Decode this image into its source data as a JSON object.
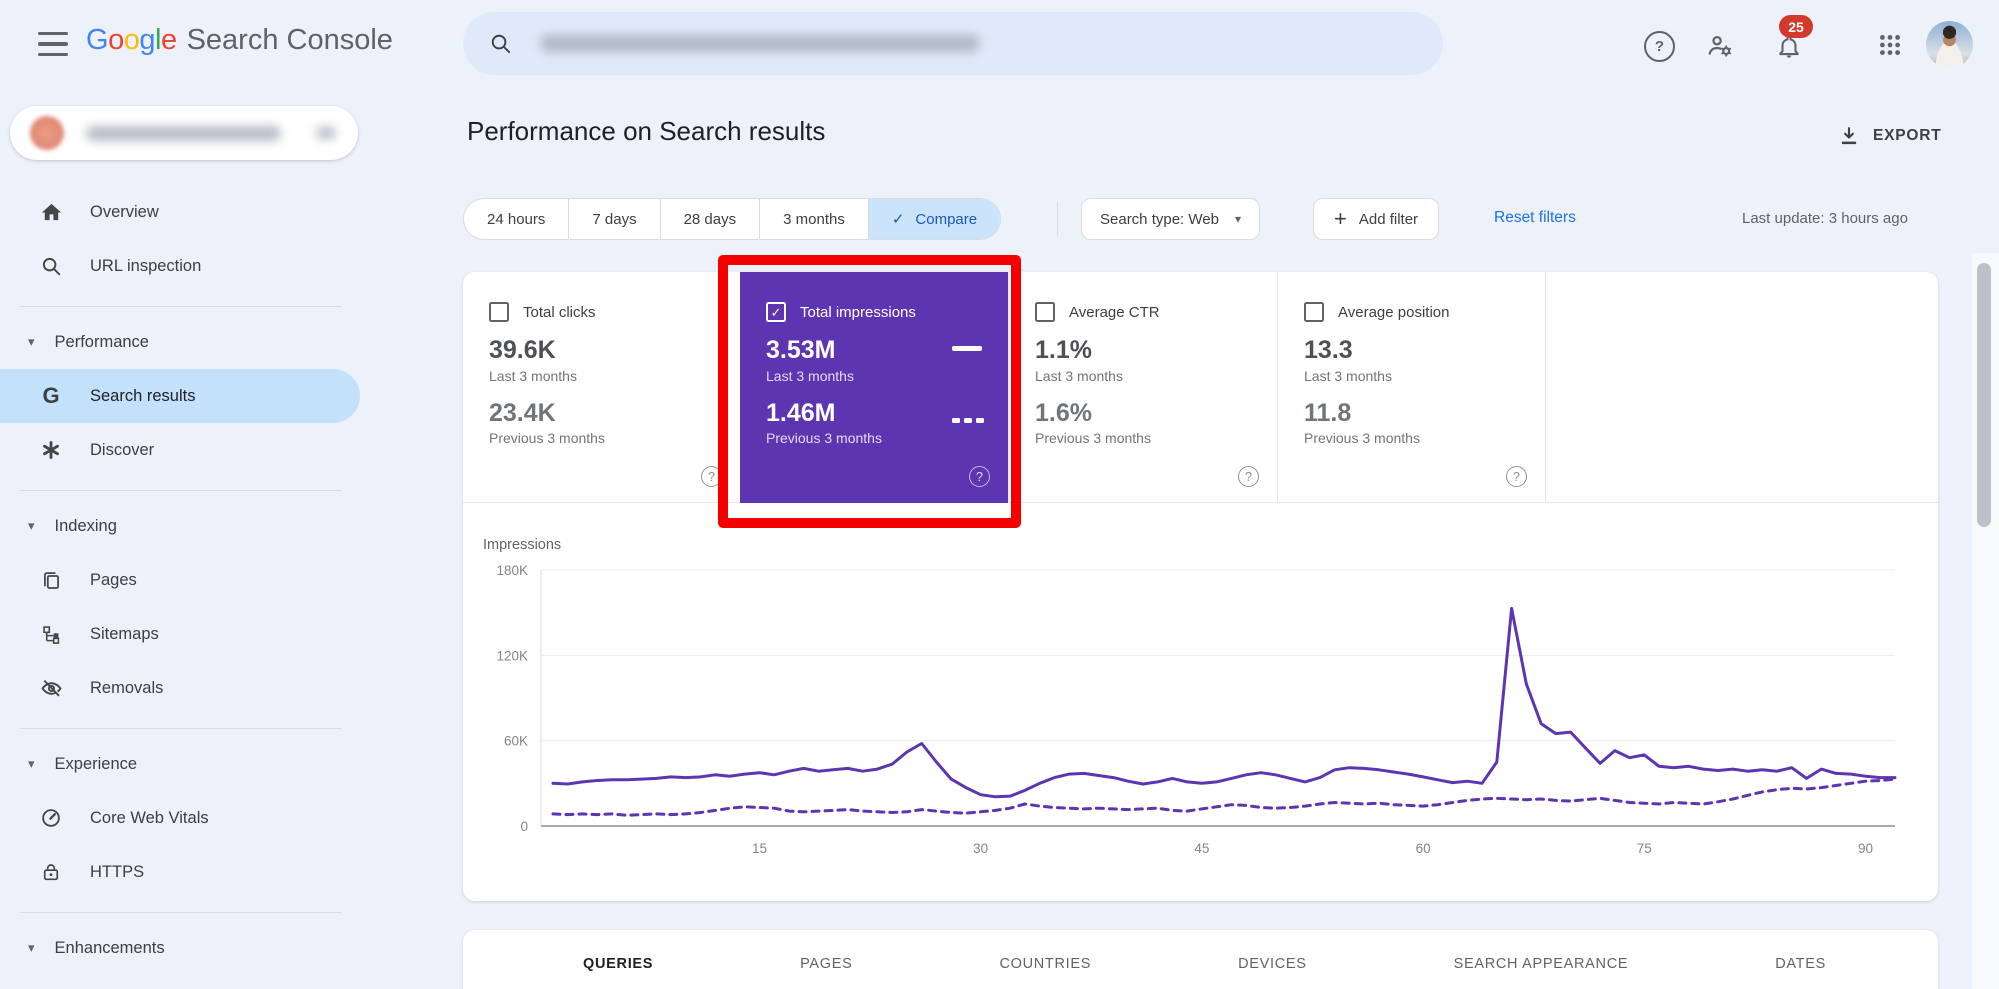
{
  "colors": {
    "page_bg": "#edf1f9",
    "accent_blue": "#1a73e8",
    "selected_chip_bg": "#cbe3fb",
    "sidebar_selected_bg": "#c3e1fb",
    "impressions_purple": "#5e35b1",
    "annotation_red": "#f50000",
    "badge_red": "#d33a2c"
  },
  "icons": {
    "compare_check": "✓",
    "checkbox_check": "✓",
    "add_filter_plus": "+",
    "dropdown_arrow": "▾",
    "section_arrow": "▾",
    "help_question": "?"
  },
  "header": {
    "logo_letters": [
      "G",
      "o",
      "o",
      "g",
      "l",
      "e"
    ],
    "logo_colors": [
      "#4285F4",
      "#EA4335",
      "#FBBC05",
      "#4285F4",
      "#34A853",
      "#EA4335"
    ],
    "logo_suffix": "Search Console",
    "notifications_badge": "25"
  },
  "sidebar": {
    "overview": "Overview",
    "url_inspection": "URL inspection",
    "performance": "Performance",
    "search_results": "Search results",
    "discover": "Discover",
    "indexing": "Indexing",
    "pages": "Pages",
    "sitemaps": "Sitemaps",
    "removals": "Removals",
    "experience": "Experience",
    "core_web_vitals": "Core Web Vitals",
    "https": "HTTPS",
    "enhancements": "Enhancements"
  },
  "main": {
    "title": "Performance on Search results",
    "export_label": "EXPORT",
    "filters": {
      "date_ranges": [
        "24 hours",
        "7 days",
        "28 days",
        "3 months"
      ],
      "compare": "Compare",
      "search_type": "Search type: Web",
      "add_filter": "Add filter",
      "reset_filters": "Reset filters",
      "last_update": "Last update: 3 hours ago"
    },
    "metric_cards": [
      {
        "label": "Total clicks",
        "checked": false,
        "current": "39.6K",
        "current_period": "Last 3 months",
        "previous": "23.4K",
        "previous_period": "Previous 3 months"
      },
      {
        "label": "Total impressions",
        "checked": true,
        "highlight_color": "#5e35b1",
        "current": "3.53M",
        "current_period": "Last 3 months",
        "previous": "1.46M",
        "previous_period": "Previous 3 months"
      },
      {
        "label": "Average CTR",
        "checked": false,
        "current": "1.1%",
        "current_period": "Last 3 months",
        "previous": "1.6%",
        "previous_period": "Previous 3 months"
      },
      {
        "label": "Average position",
        "checked": false,
        "current": "13.3",
        "current_period": "Last 3 months",
        "previous": "11.8",
        "previous_period": "Previous 3 months"
      }
    ],
    "tabs": [
      {
        "label": "QUERIES",
        "active": true
      },
      {
        "label": "PAGES",
        "active": false
      },
      {
        "label": "COUNTRIES",
        "active": false
      },
      {
        "label": "DEVICES",
        "active": false
      },
      {
        "label": "SEARCH APPEARANCE",
        "active": false
      },
      {
        "label": "DATES",
        "active": false
      }
    ]
  },
  "annotation": {
    "shape": "highlight-box",
    "color": "#f50000"
  },
  "chart_data": {
    "type": "line",
    "title": "Impressions",
    "unit": "impressions",
    "days": 92,
    "grid": true,
    "ylim": [
      0,
      180000
    ],
    "x_axis": {
      "ticks": [
        15,
        30,
        45,
        60,
        75,
        90
      ]
    },
    "y_axis": {
      "ticks": [
        {
          "value": 0,
          "label": "0"
        },
        {
          "value": 60000,
          "label": "60K"
        },
        {
          "value": 120000,
          "label": "120K"
        },
        {
          "value": 180000,
          "label": "180K"
        }
      ]
    },
    "series": [
      {
        "name": "Total impressions - Last 3 months",
        "style": "solid",
        "color": "#5e35b1",
        "values": [
          30000,
          29500,
          31000,
          32000,
          32500,
          32500,
          33000,
          33500,
          34500,
          34000,
          34500,
          36000,
          35000,
          36500,
          37500,
          36000,
          38500,
          40500,
          38500,
          39500,
          40500,
          38500,
          40000,
          43500,
          52000,
          58000,
          45000,
          33000,
          27000,
          22000,
          20500,
          21000,
          25000,
          30000,
          34000,
          36500,
          37000,
          35500,
          34000,
          31500,
          29500,
          31000,
          33500,
          31000,
          30000,
          31000,
          33500,
          36000,
          37500,
          36000,
          33500,
          31000,
          34000,
          39500,
          41000,
          40500,
          39500,
          38000,
          36500,
          34500,
          32500,
          30500,
          31500,
          30000,
          45000,
          153000,
          100000,
          72000,
          65000,
          66000,
          55000,
          44000,
          53000,
          48000,
          50000,
          42000,
          41000,
          42000,
          40000,
          39000,
          40000,
          38500,
          39500,
          38500,
          41000,
          33500,
          40000,
          37000,
          36500,
          35000,
          34000,
          34000
        ]
      },
      {
        "name": "Total impressions - Previous 3 months",
        "style": "dashed",
        "color": "#5e35b1",
        "values": [
          8500,
          8000,
          8500,
          8000,
          8500,
          7500,
          8000,
          8500,
          8000,
          8500,
          9500,
          11000,
          12500,
          13500,
          13000,
          12500,
          10500,
          10000,
          10500,
          11000,
          11500,
          10500,
          10000,
          9500,
          10000,
          11500,
          10500,
          9500,
          9000,
          10000,
          11000,
          12500,
          15500,
          14000,
          13000,
          12500,
          12000,
          12500,
          12000,
          11500,
          12000,
          12500,
          11000,
          10500,
          12000,
          13500,
          15000,
          14500,
          13000,
          12500,
          13000,
          14000,
          15500,
          16500,
          16000,
          15500,
          16000,
          15000,
          14500,
          14000,
          15000,
          16500,
          18000,
          19000,
          19500,
          19000,
          18500,
          19000,
          18000,
          17500,
          18500,
          19500,
          18000,
          16500,
          16000,
          15500,
          16500,
          16000,
          15500,
          17000,
          19000,
          21500,
          24000,
          25500,
          26500,
          26000,
          27000,
          28500,
          30000,
          31500,
          32000,
          33000
        ]
      }
    ]
  }
}
